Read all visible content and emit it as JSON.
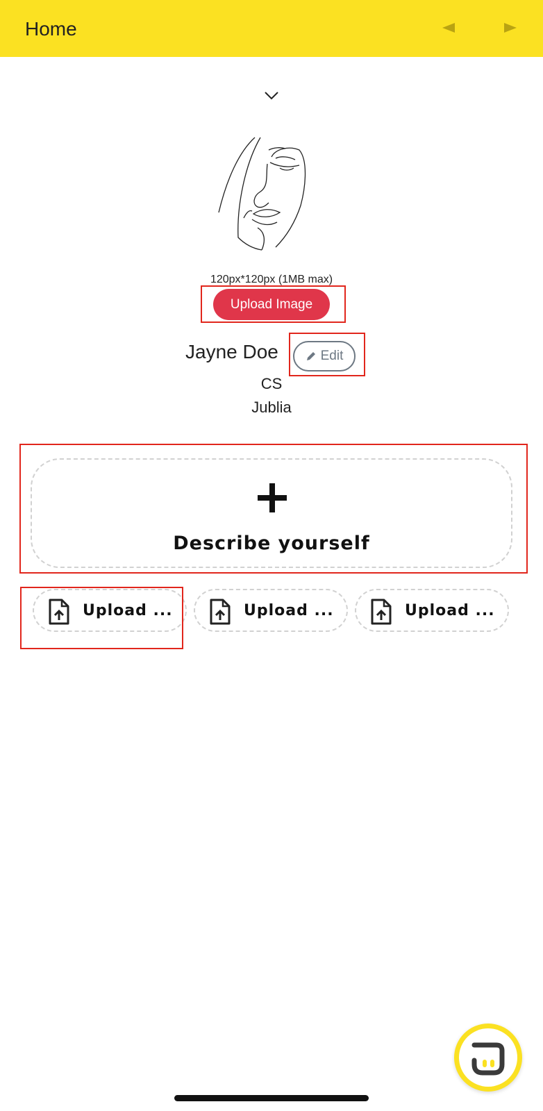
{
  "header": {
    "title": "Home",
    "back_icon": "triangle-left-icon",
    "forward_icon": "triangle-right-icon"
  },
  "profile": {
    "collapse_icon": "chevron-down-icon",
    "size_hint": "120px*120px (1MB max)",
    "upload_image_label": "Upload Image",
    "name": "Jayne Doe",
    "edit_label": "Edit",
    "department": "CS",
    "company": "Jublia"
  },
  "describe": {
    "icon": "plus-icon",
    "label": "Describe yourself"
  },
  "uploads": [
    {
      "label": "Upload ...",
      "icon": "file-upload-icon"
    },
    {
      "label": "Upload ...",
      "icon": "file-upload-icon"
    },
    {
      "label": "Upload ...",
      "icon": "file-upload-icon"
    }
  ],
  "colors": {
    "header_bg": "#fbe122",
    "accent_red": "#e0364a",
    "highlight_red": "#e1261c",
    "dashed_border": "#d1d1d1"
  }
}
